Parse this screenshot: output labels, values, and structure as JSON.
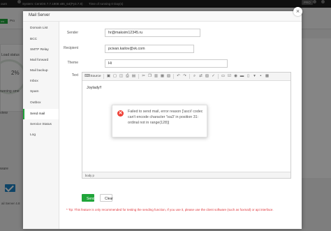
{
  "background": {
    "topbar": {
      "account": "ount",
      "system": "System:  CentOS 7.7.1908 x86_64(Py3.7.8)",
      "uptime": "Time of running 0 Day(s)",
      "pro": "PRO"
    },
    "status_tag": "ow",
    "tab": "Pro",
    "load_status": "Load status",
    "gauge_value": "2%",
    "running": "running smo",
    "overview": "view",
    "software": "ware",
    "mail_server": "ail Server 4.8"
  },
  "modal": {
    "title": "Mail Server",
    "close_glyph": "×"
  },
  "menu": [
    "Domain List",
    "BCC",
    "SMTP Relay",
    "Mail forward",
    "Mail backup",
    "Inbox",
    "Spam",
    "Outbox",
    "Send mail",
    "Service Status",
    "Log"
  ],
  "form": {
    "sender_label": "Sender",
    "sender_value": "hr@maksim12345.ru",
    "recipient_label": "Recipient",
    "recipient_value": "pcivan.kailov@vk.com",
    "theme_label": "Theme",
    "theme_value": "Hi",
    "text_label": "Text"
  },
  "editor": {
    "source_label": "Source",
    "content": "Joylady!!",
    "path": "body  p",
    "toolbar_icons": [
      {
        "name": "save-icon",
        "glyph": "▣"
      },
      {
        "name": "new-page-icon",
        "glyph": "▢"
      },
      {
        "name": "preview-icon",
        "glyph": "◫"
      },
      {
        "name": "print-icon",
        "glyph": "⎙"
      },
      {
        "name": "templates-icon",
        "glyph": "▤"
      },
      {
        "name": "cut-icon",
        "glyph": "✂"
      },
      {
        "name": "copy-icon",
        "glyph": "❐"
      },
      {
        "name": "paste-icon",
        "glyph": "▥"
      },
      {
        "name": "paste-text-icon",
        "glyph": "▦"
      },
      {
        "name": "paste-word-icon",
        "glyph": "▧"
      },
      {
        "name": "undo-icon",
        "glyph": "↶"
      },
      {
        "name": "redo-icon",
        "glyph": "↷"
      },
      {
        "name": "find-icon",
        "glyph": "⌕"
      },
      {
        "name": "replace-icon",
        "glyph": "⇄"
      },
      {
        "name": "select-all-icon",
        "glyph": "▨"
      },
      {
        "name": "spellcheck-icon",
        "glyph": "✓"
      },
      {
        "name": "form-icon",
        "glyph": "▭"
      },
      {
        "name": "checkbox-icon",
        "glyph": "☑"
      },
      {
        "name": "radio-icon",
        "glyph": "◉"
      },
      {
        "name": "textfield-icon",
        "glyph": "▬"
      },
      {
        "name": "textarea-icon",
        "glyph": "▯"
      },
      {
        "name": "select-icon",
        "glyph": "▾"
      },
      {
        "name": "button-icon",
        "glyph": "▪"
      },
      {
        "name": "image-button-icon",
        "glyph": "▩"
      }
    ]
  },
  "alert": {
    "icon_glyph": "✕",
    "message": "Failed to send mail, error reason ['ascii' codec can't encode character '\\xa3' in position 31: ordinal not in range(128)]"
  },
  "buttons": {
    "send": "Send",
    "clear": "Clear"
  },
  "tip": "* Tip: This feature is only recommended for testing the sending function, If you use it, please use the client software (such as foxmail) or api interface.",
  "colors": {
    "accent": "#20a53a",
    "error": "#ef3f35",
    "tip": "#e0343a"
  }
}
